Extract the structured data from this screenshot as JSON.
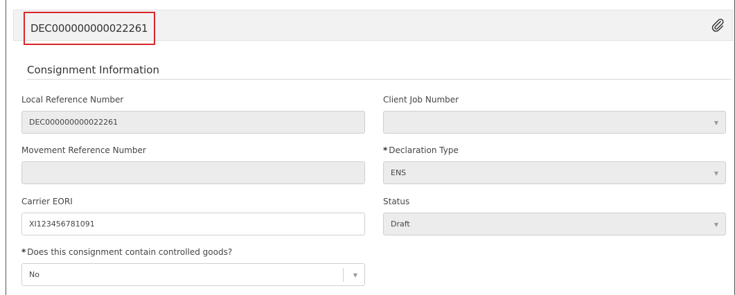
{
  "header": {
    "title": "DEC000000000022261",
    "highlight_color": "#d9262a",
    "attach_icon": "paperclip-icon"
  },
  "section": {
    "title": "Consignment Information"
  },
  "fields": {
    "lrn": {
      "label": "Local Reference Number",
      "value": "DEC000000000022261",
      "readonly": true
    },
    "client_job": {
      "label": "Client Job Number",
      "value": "",
      "readonly": true
    },
    "mrn": {
      "label": "Movement Reference Number",
      "value": "",
      "readonly": true
    },
    "declaration_type": {
      "required_mark": "*",
      "label": "Declaration Type",
      "value": "ENS",
      "readonly": true
    },
    "carrier_eori": {
      "label": "Carrier EORI",
      "value": "XI123456781091"
    },
    "status": {
      "label": "Status",
      "value": "Draft",
      "readonly": true
    },
    "controlled_goods": {
      "required_mark": "*",
      "label": "Does this consignment contain controlled goods?",
      "value": "No"
    }
  },
  "icons": {
    "dropdown": "chevron-down-icon"
  }
}
